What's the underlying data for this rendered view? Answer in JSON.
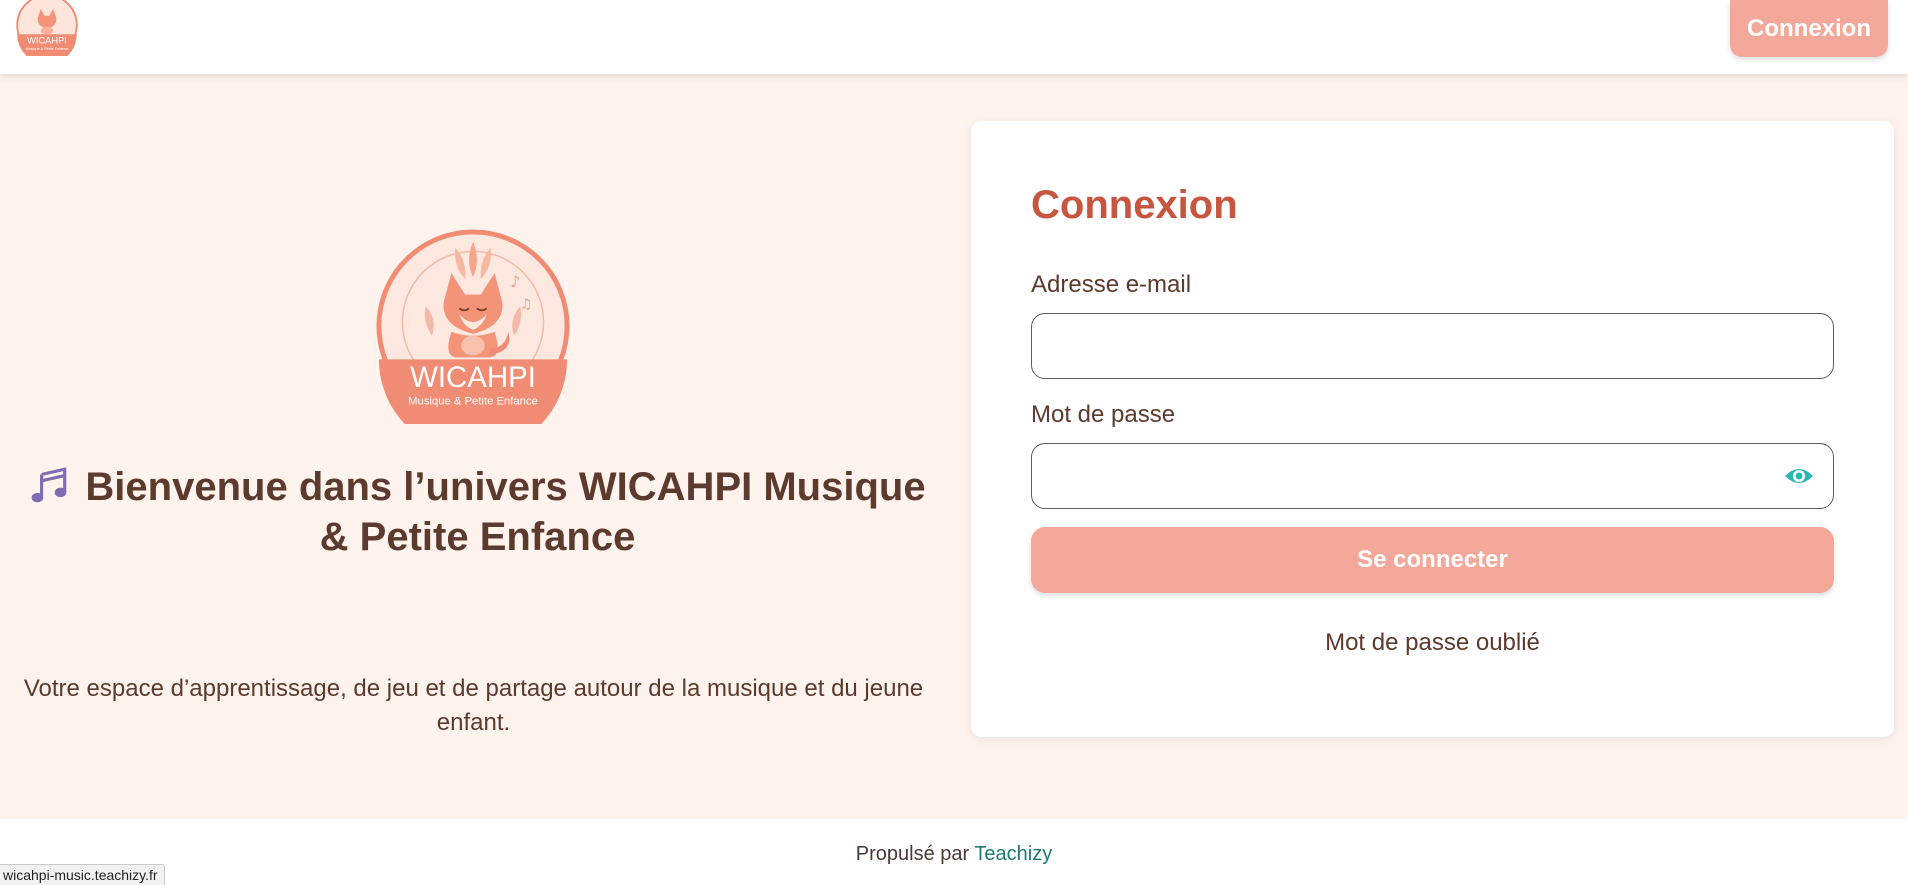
{
  "header": {
    "login_button": "Connexion",
    "logo": {
      "name": "WICAHPI",
      "tagline": "Musique & Petite Enfance"
    }
  },
  "welcome": {
    "title": "Bienvenue dans l’univers WICAHPI Musique & Petite Enfance",
    "subtitle": "Votre espace d’apprentissage, de jeu et de partage autour de la musique et du jeune enfant.",
    "logo": {
      "name": "WICAHPI",
      "tagline": "Musique & Petite Enfance"
    },
    "title_icon": "music-notes-icon"
  },
  "login": {
    "title": "Connexion",
    "email_label": "Adresse e-mail",
    "email_value": "",
    "password_label": "Mot de passe",
    "password_value": "",
    "password_toggle_icon": "eye-icon",
    "submit_label": "Se connecter",
    "forgot_label": "Mot de passe oublié"
  },
  "footer": {
    "prefix": "Propulsé par",
    "link": "Teachizy"
  },
  "status_bar": {
    "url": "wicahpi-music.teachizy.fr"
  },
  "colors": {
    "page_bg": "#fff3ee",
    "accent": "#f3a899",
    "title_accent": "#c8553f",
    "text": "#5c3a2e",
    "eye_icon": "#2bb7b3",
    "footer_link": "#1f7a73"
  }
}
